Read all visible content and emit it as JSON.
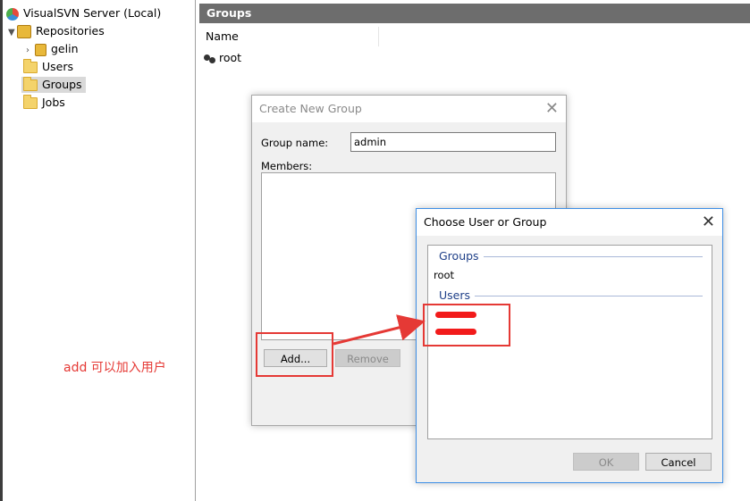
{
  "tree": {
    "root_label": "VisualSVN Server (Local)",
    "repositories_label": "Repositories",
    "repo_items": [
      "gelin"
    ],
    "users_label": "Users",
    "groups_label": "Groups",
    "jobs_label": "Jobs"
  },
  "main": {
    "header_title": "Groups",
    "column_name": "Name",
    "rows": [
      "root"
    ]
  },
  "create_group_dialog": {
    "title": "Create New Group",
    "group_name_label": "Group name:",
    "group_name_value": "admin",
    "members_label": "Members:",
    "add_button": "Add...",
    "remove_button": "Remove"
  },
  "choose_dialog": {
    "title": "Choose User or Group",
    "groups_section": "Groups",
    "groups": [
      "root"
    ],
    "users_section": "Users",
    "ok_button": "OK",
    "cancel_button": "Cancel"
  },
  "annotation": {
    "text": "add 可以加入用户",
    "color": "#e53935"
  }
}
